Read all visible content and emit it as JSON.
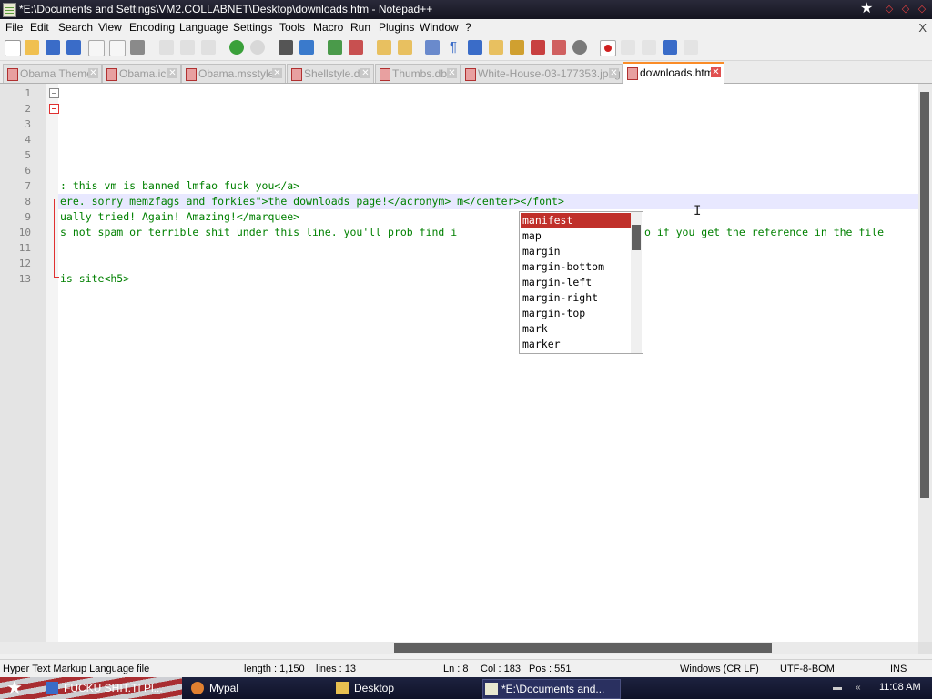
{
  "window": {
    "title": "*E:\\Documents and Settings\\VM2.COLLABNET\\Desktop\\downloads.htm - Notepad++",
    "star": "★",
    "controls": {
      "minimize": "◇",
      "restore": "◇",
      "close": "◇"
    }
  },
  "menu": {
    "items": [
      "File",
      "Edit",
      "Search",
      "View",
      "Encoding",
      "Language",
      "Settings",
      "Tools",
      "Macro",
      "Run",
      "Plugins",
      "Window",
      "?"
    ],
    "close": "X"
  },
  "toolbar": {
    "icons": [
      "new-file-icon",
      "open-file-icon",
      "save-icon",
      "save-all-icon",
      "close-icon",
      "close-all-icon",
      "print-icon",
      "cut-icon",
      "copy-icon",
      "paste-icon",
      "undo-icon",
      "redo-icon",
      "find-icon",
      "replace-icon",
      "zoom-in-icon",
      "zoom-out-icon",
      "sync-v-icon",
      "sync-h-icon",
      "word-wrap-icon",
      "show-all-chars-icon",
      "indent-guide-icon",
      "doc-map-icon",
      "function-list-icon",
      "folder-workspace-icon",
      "monitoring-icon",
      "record-macro-icon",
      "stop-macro-icon",
      "play-macro-icon",
      "run-macro-multiple-icon",
      "save-macro-icon"
    ]
  },
  "tabs": [
    {
      "label": "Obama Theme",
      "active": false
    },
    {
      "label": "Obama.icl",
      "active": false
    },
    {
      "label": "Obama.msstyles",
      "active": false
    },
    {
      "label": "Shellstyle.dll",
      "active": false
    },
    {
      "label": "Thumbs.db",
      "active": false
    },
    {
      "label": "White-House-03-177353.jpeg",
      "active": false
    },
    {
      "label": "downloads.htm",
      "active": true
    }
  ],
  "editor": {
    "line_numbers": [
      "1",
      "2",
      "3",
      "4",
      "5",
      "6",
      "7",
      "8",
      "9",
      "10",
      "11",
      "12",
      "13"
    ],
    "lines": {
      "l7": ": this vm is banned lmfao fuck you</a>",
      "l8": "ere. sorry memzfags and forkies\">the downloads page!</acronym> m</center></font>",
      "l9": "ually tried! Again! Amazing!</marquee>",
      "l10": "s not spam or terrible shit under this line. you'll prob find i",
      "l10b": "o if you get the reference in the file",
      "l13": "is site<h5>"
    }
  },
  "autocomplete": {
    "items": [
      "manifest",
      "map",
      "margin",
      "margin-bottom",
      "margin-left",
      "margin-right",
      "margin-top",
      "mark",
      "marker"
    ],
    "selected": "manifest"
  },
  "status": {
    "file_type": "Hyper Text Markup Language file",
    "length": "length : 1,150",
    "lines": "lines : 13",
    "ln": "Ln : 8",
    "col": "Col : 183",
    "pos": "Pos : 551",
    "eol": "Windows (CR LF)",
    "encoding": "UTF-8-BOM",
    "mode": "INS"
  },
  "taskbar": {
    "start": "★",
    "tasks": [
      {
        "label": "FUCKU SHIT.TI Pl..."
      },
      {
        "label": "Mypal"
      },
      {
        "label": "Desktop"
      },
      {
        "label": "*E:\\Documents and..."
      }
    ],
    "clock": "11:08 AM"
  }
}
